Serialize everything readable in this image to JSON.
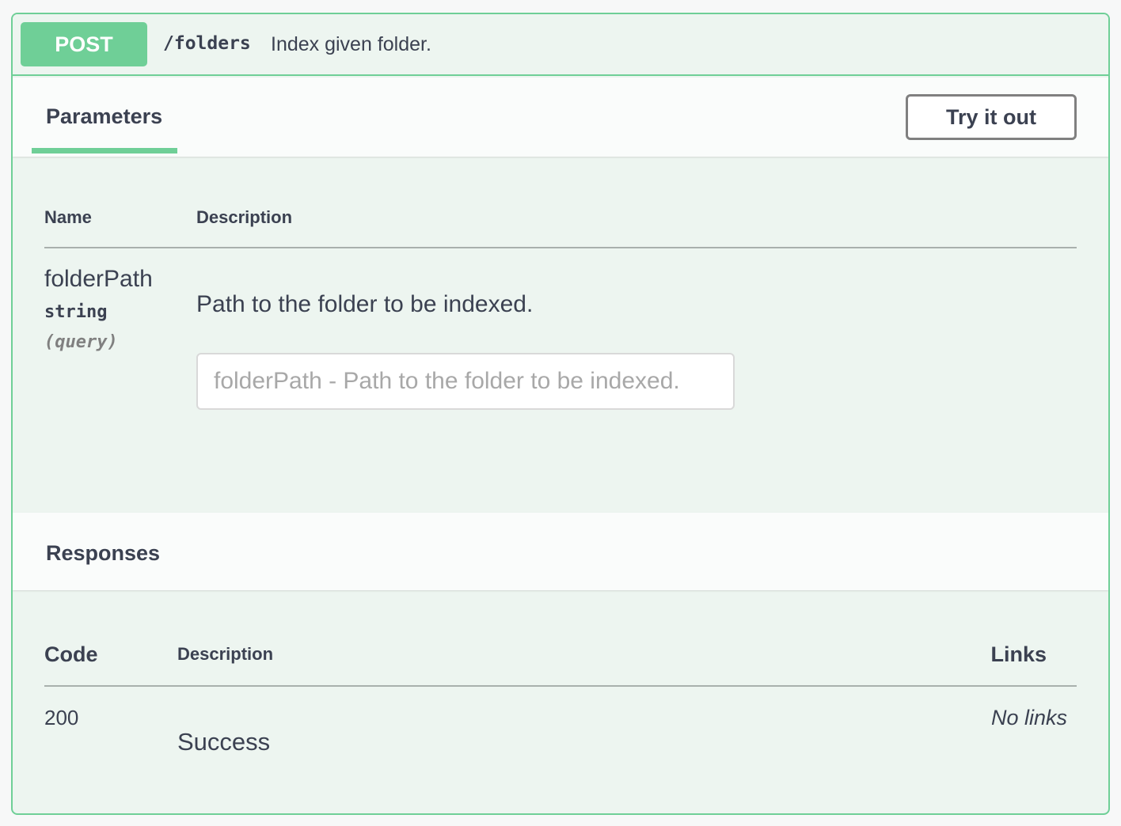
{
  "operation": {
    "method": "POST",
    "path": "/folders",
    "summary": "Index given folder."
  },
  "parameters_section": {
    "tab_label": "Parameters",
    "try_button_label": "Try it out",
    "columns": {
      "name": "Name",
      "description": "Description"
    },
    "params": [
      {
        "name": "folderPath",
        "type": "string",
        "in": "(query)",
        "description": "Path to the folder to be indexed.",
        "input_placeholder": "folderPath - Path to the folder to be indexed.",
        "input_value": ""
      }
    ]
  },
  "responses_section": {
    "title": "Responses",
    "columns": {
      "code": "Code",
      "description": "Description",
      "links": "Links"
    },
    "rows": [
      {
        "code": "200",
        "description": "Success",
        "links": "No links"
      }
    ]
  },
  "colors": {
    "accent_green": "#6fcf97",
    "panel_background": "#edf5f0",
    "text": "#3b4151"
  }
}
